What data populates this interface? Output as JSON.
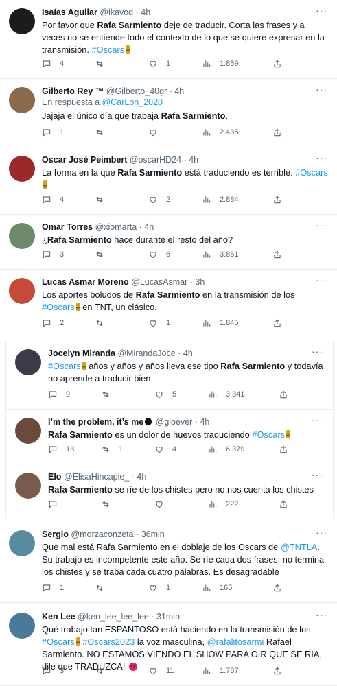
{
  "tweets": [
    {
      "name": "Isaías Aguilar",
      "handle": "@ikavod",
      "time": "· 4h",
      "avatar_color": "#1c1c1c",
      "segments": [
        {
          "t": "Por favor que "
        },
        {
          "t": "Rafa Sarmiento",
          "b": true
        },
        {
          "t": " deje de traducir. Corta las frases y a veces no se entiende todo el contexto de lo que se quiere expresar en la transmisión. "
        },
        {
          "t": "#Oscars",
          "tag": true
        },
        {
          "e": "trophy"
        }
      ],
      "replies": "4",
      "retweets": "",
      "likes": "1",
      "views": "1.859"
    },
    {
      "name": "Gilberto Rey ™",
      "handle": "@Gilberto_40gr",
      "time": "· 4h",
      "avatar_color": "#8a6a4a",
      "reply_prefix": "En respuesta a ",
      "reply_to": "@CarLon_2020",
      "segments": [
        {
          "t": "Jajaja el único día que trabaja "
        },
        {
          "t": "Rafa Sarmiento",
          "b": true
        },
        {
          "t": "."
        }
      ],
      "replies": "1",
      "retweets": "",
      "likes": "",
      "views": "2.435"
    },
    {
      "name": "Oscar José Peimbert",
      "handle": "@oscarHD24",
      "time": "· 4h",
      "avatar_color": "#9a2a2a",
      "segments": [
        {
          "t": "La forma en la que "
        },
        {
          "t": "Rafa Sarmiento",
          "b": true
        },
        {
          "t": " está traduciendo es terrible. "
        },
        {
          "t": "#Oscars",
          "tag": true
        },
        {
          "e": "trophy"
        }
      ],
      "replies": "4",
      "retweets": "",
      "likes": "2",
      "views": "2.884"
    },
    {
      "name": "Omar Torres",
      "handle": "@xiomarta",
      "time": "· 4h",
      "avatar_color": "#6a8a6a",
      "segments": [
        {
          "t": "¿"
        },
        {
          "t": "Rafa Sarmiento",
          "b": true
        },
        {
          "t": " hace durante el resto del año?"
        }
      ],
      "replies": "3",
      "retweets": "",
      "likes": "6",
      "views": "3.861"
    },
    {
      "name": "Lucas Asmar Moreno",
      "handle": "@LucasAsmar",
      "time": "· 3h",
      "avatar_color": "#c44a3a",
      "segments": [
        {
          "t": "Los aportes boludos de "
        },
        {
          "t": "Rafa Sarmiento",
          "b": true
        },
        {
          "t": " en la transmisión de los "
        },
        {
          "t": "#Oscars",
          "tag": true
        },
        {
          "e": "trophy"
        },
        {
          "t": " en TNT, un clásico."
        }
      ],
      "replies": "2",
      "retweets": "",
      "likes": "1",
      "views": "1.845"
    },
    {
      "name": "Jocelyn Miranda",
      "handle": "@MirandaJoce",
      "time": "· 4h",
      "avatar_color": "#3a3a4a",
      "segments": [
        {
          "t": "#Oscars",
          "tag": true
        },
        {
          "e": "trophy"
        },
        {
          "t": " años y años y años lleva ese tipo "
        },
        {
          "t": "Rafa Sarmiento",
          "b": true
        },
        {
          "t": " y todavía no aprende a traducir bien"
        }
      ],
      "replies": "9",
      "retweets": "",
      "likes": "5",
      "views": "3.341"
    },
    {
      "name": "I’m the problem, it’s me",
      "name_icon": "apple",
      "handle": "@gioever",
      "time": "· 4h",
      "avatar_color": "#6a4a3a",
      "segments": [
        {
          "b": true,
          "t": "Rafa Sarmiento"
        },
        {
          "t": " es un dolor de huevos traduciendo "
        },
        {
          "t": "#Oscars",
          "tag": true
        },
        {
          "e": "trophy"
        }
      ],
      "replies": "13",
      "retweets": "1",
      "likes": "4",
      "views": "6.379"
    },
    {
      "name": "Elo",
      "handle": "@ElisaHincapie_",
      "time": "· 4h",
      "avatar_color": "#7a5a4a",
      "segments": [
        {
          "b": true,
          "t": "Rafa Sarmiento"
        },
        {
          "t": " se ríe de los chistes pero no nos cuenta los chistes"
        }
      ],
      "replies": "",
      "retweets": "",
      "likes": "",
      "views": "222"
    },
    {
      "name": "Sergio",
      "handle": "@morzaconzeta",
      "time": "· 36min",
      "avatar_color": "#5a8aa0",
      "segments": [
        {
          "t": "Que mal está Rafa Sarmiento en el doblaje de los Oscars de "
        },
        {
          "t": "@TNTLA",
          "tag": true
        },
        {
          "t": ". Su trabajo es incompetente este año. Se ríe cada dos frases, no termina los chistes y se traba cada cuatro palabras. Es desagradable"
        }
      ],
      "replies": "1",
      "retweets": "",
      "likes": "1",
      "views": "165"
    },
    {
      "name": "Ken Lee",
      "handle": "@ken_lee_lee_lee",
      "time": "· 31min",
      "avatar_color": "#4a7a9a",
      "segments": [
        {
          "t": "Qué trabajo tan ESPANTOSO está haciendo en la transmisión de los "
        },
        {
          "t": "#Oscars",
          "tag": true
        },
        {
          "e": "trophy"
        },
        {
          "t": " "
        },
        {
          "t": "#Oscars2023",
          "tag": true
        },
        {
          "t": " la voz masculina, "
        },
        {
          "t": "@rafalitosarmi",
          "tag": true
        },
        {
          "t": " Rafael Sarmiento. NO ESTAMOS VIENDO EL SHOW PARA OIR QUE SE RIA, dile que TRADUZCA! "
        },
        {
          "e": "angry"
        }
      ],
      "replies": "3",
      "retweets": "",
      "likes": "11",
      "views": "1.787"
    }
  ]
}
